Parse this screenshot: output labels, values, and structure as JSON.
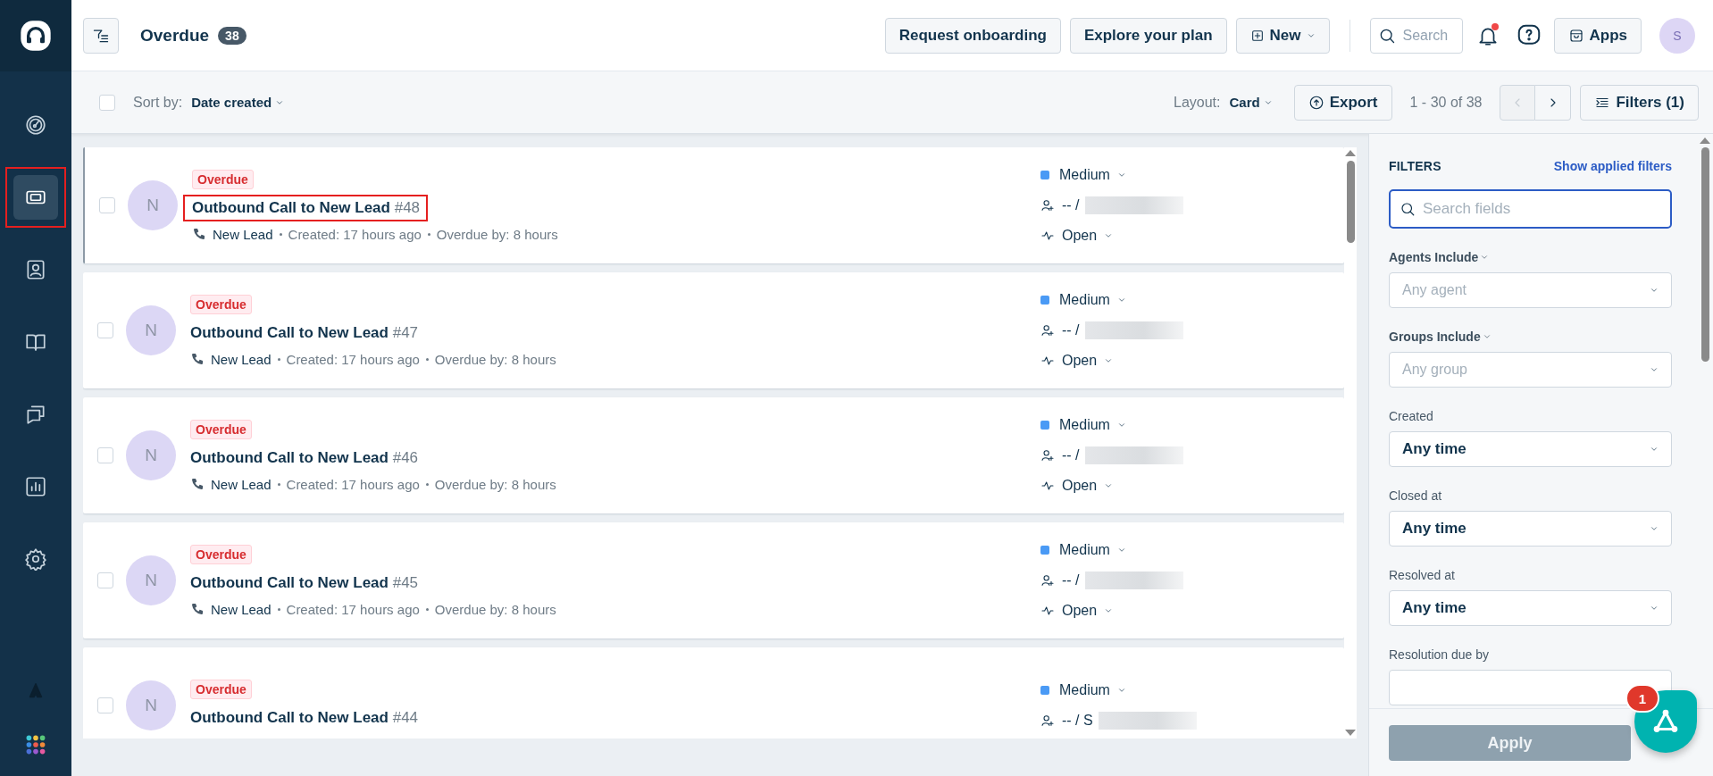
{
  "app_sidebar": {
    "items": [
      {
        "kind": "gauge",
        "selected": false
      },
      {
        "kind": "ticket",
        "selected": true,
        "highlighted": true
      },
      {
        "kind": "contact",
        "selected": false
      },
      {
        "kind": "book",
        "selected": false
      },
      {
        "kind": "chat",
        "selected": false
      },
      {
        "kind": "chart",
        "selected": false
      },
      {
        "kind": "gear",
        "selected": false
      }
    ],
    "bottom": [
      {
        "kind": "tree"
      },
      {
        "kind": "dots"
      }
    ]
  },
  "topbar": {
    "title": "Overdue",
    "count": "38",
    "buttons": [
      "Request onboarding",
      "Explore your plan"
    ],
    "new_button": "New",
    "search_placeholder": "Search",
    "notifications_unread": true,
    "apps_label": "Apps",
    "avatar": "S"
  },
  "toolbar": {
    "select_all_checked": false,
    "sort_label": "Sort by:",
    "sort_value": "Date created",
    "layout_label": "Layout:",
    "layout_value": "Card",
    "export": "Export",
    "range": "1 - 30 of 38",
    "prev_disabled": true,
    "filters_button": "Filters (1)"
  },
  "tickets": [
    {
      "checked": false,
      "highlighted": true,
      "badge": "Overdue",
      "avatar": "N",
      "title": "Outbound Call to New Lead",
      "number": "#48",
      "source": "New Lead",
      "created": "Created: 17 hours ago",
      "overdue": "Overdue by: 8 hours",
      "priority": "Medium",
      "color": "#4a9af5",
      "assignee": "-- /",
      "status": "Open"
    },
    {
      "checked": false,
      "highlighted": false,
      "badge": "Overdue",
      "avatar": "N",
      "title": "Outbound Call to New Lead",
      "number": "#47",
      "source": "New Lead",
      "created": "Created: 17 hours ago",
      "overdue": "Overdue by: 8 hours",
      "priority": "Medium",
      "color": "#4a9af5",
      "assignee": "-- /",
      "status": "Open"
    },
    {
      "checked": false,
      "highlighted": false,
      "badge": "Overdue",
      "avatar": "N",
      "title": "Outbound Call to New Lead",
      "number": "#46",
      "source": "New Lead",
      "created": "Created: 17 hours ago",
      "overdue": "Overdue by: 8 hours",
      "priority": "Medium",
      "color": "#4a9af5",
      "assignee": "-- /",
      "status": "Open"
    },
    {
      "checked": false,
      "highlighted": false,
      "badge": "Overdue",
      "avatar": "N",
      "title": "Outbound Call to New Lead",
      "number": "#45",
      "source": "New Lead",
      "created": "Created: 17 hours ago",
      "overdue": "Overdue by: 8 hours",
      "priority": "Medium",
      "color": "#4a9af5",
      "assignee": "-- /",
      "status": "Open"
    },
    {
      "checked": false,
      "highlighted": false,
      "badge": "Overdue",
      "avatar": "N",
      "title": "Outbound Call to New Lead",
      "number": "#44",
      "priority": "Medium",
      "color": "#4a9af5",
      "assignee": "-- / S"
    }
  ],
  "filters": {
    "title": "FILTERS",
    "show_applied": "Show applied filters",
    "search_placeholder": "Search fields",
    "fields": [
      {
        "label": "Agents Include",
        "has_menu": true,
        "placeholder": "Any agent"
      },
      {
        "label": "Groups Include",
        "has_menu": true,
        "placeholder": "Any group"
      },
      {
        "label": "Created",
        "has_menu": false,
        "value": "Any time"
      },
      {
        "label": "Closed at",
        "has_menu": false,
        "value": "Any time"
      },
      {
        "label": "Resolved at",
        "has_menu": false,
        "value": "Any time"
      },
      {
        "label": "Resolution due by",
        "has_menu": false
      }
    ],
    "apply": "Apply",
    "apply_disabled": true
  },
  "fab": {
    "badge": "1"
  }
}
